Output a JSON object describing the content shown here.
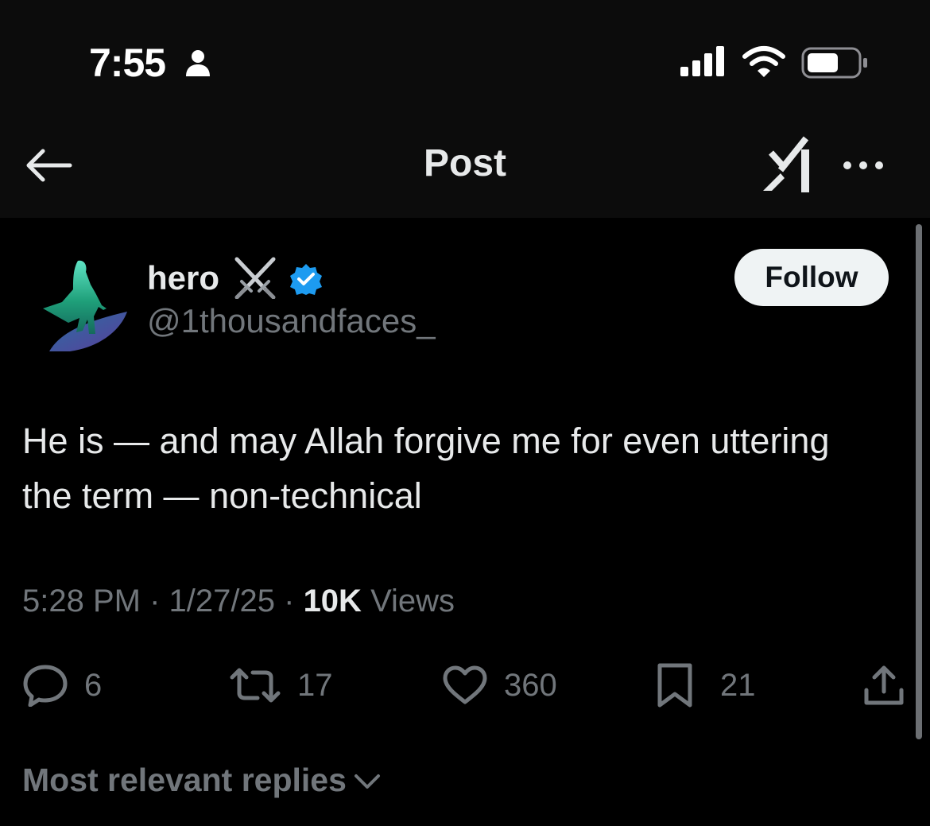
{
  "status_bar": {
    "time": "7:55"
  },
  "nav": {
    "title": "Post"
  },
  "author": {
    "display_name": "hero",
    "handle": "@1thousandfaces_"
  },
  "follow_label": "Follow",
  "tweet": {
    "text": "He is — and may Allah forgive me for even uttering the term — non-technical",
    "time": "5:28 PM",
    "date": "1/27/25",
    "views_count": "10K",
    "views_label": "Views"
  },
  "actions": {
    "replies": "6",
    "reposts": "17",
    "likes": "360",
    "bookmarks": "21"
  },
  "replies_sort": {
    "label": "Most relevant replies"
  },
  "colors": {
    "background": "#000000",
    "text": "#e7e9ea",
    "secondary": "#71767b",
    "verified": "#1d9bf0",
    "follow_bg": "#eff3f4"
  }
}
